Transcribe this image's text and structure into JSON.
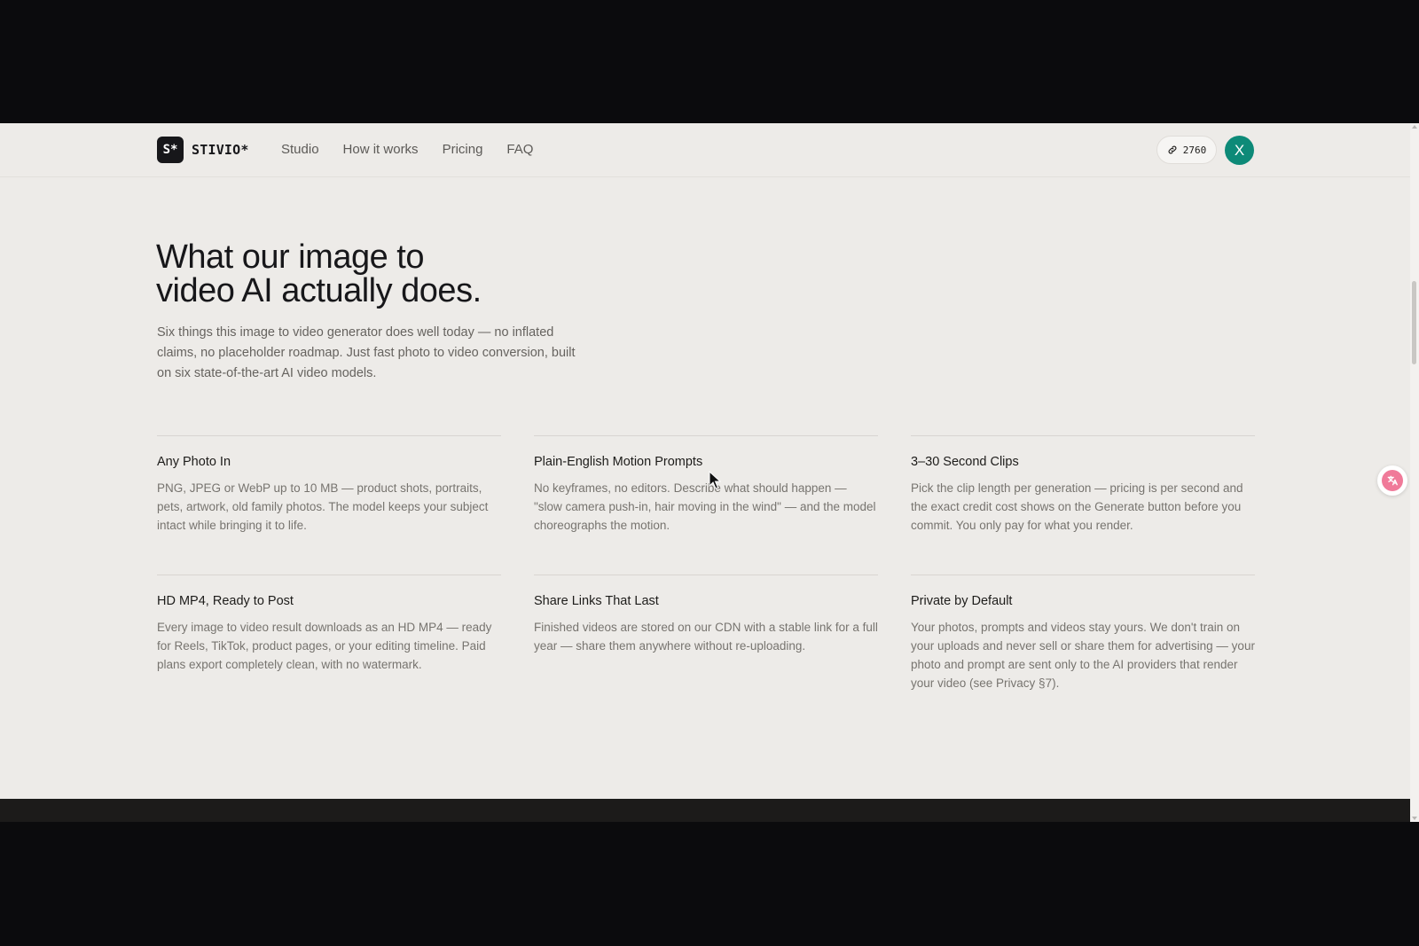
{
  "header": {
    "logo_mark": "S*",
    "logo_text": "STIVIO*",
    "nav": [
      "Studio",
      "How it works",
      "Pricing",
      "FAQ"
    ],
    "credits": "2760",
    "avatar_initial": "X"
  },
  "hero": {
    "title_line1": "What our image to",
    "title_line2": "video AI actually does.",
    "subtitle": "Six things this image to video generator does well today — no inflated claims, no placeholder roadmap. Just fast photo to video conversion, built on six state-of-the-art AI video models."
  },
  "features": [
    {
      "title": "Any Photo In",
      "text": "PNG, JPEG or WebP up to 10 MB — product shots, portraits, pets, artwork, old family photos. The model keeps your subject intact while bringing it to life."
    },
    {
      "title": "Plain-English Motion Prompts",
      "text": "No keyframes, no editors. Describe what should happen — \"slow camera push-in, hair moving in the wind\" — and the model choreographs the motion."
    },
    {
      "title": "3–30 Second Clips",
      "text": "Pick the clip length per generation — pricing is per second and the exact credit cost shows on the Generate button before you commit. You only pay for what you render."
    },
    {
      "title": "HD MP4, Ready to Post",
      "text": "Every image to video result downloads as an HD MP4 — ready for Reels, TikTok, product pages, or your editing timeline. Paid plans export completely clean, with no watermark."
    },
    {
      "title": "Share Links That Last",
      "text": "Finished videos are stored on our CDN with a stable link for a full year — share them anywhere without re-uploading."
    },
    {
      "title": "Private by Default",
      "text": "Your photos, prompts and videos stay yours. We don't train on your uploads and never sell or share them for advertising — your photo and prompt are sent only to the AI providers that render your video (see Privacy §7)."
    }
  ],
  "icons": {
    "credits": "link-icon",
    "widget": "translate-icon"
  },
  "colors": {
    "page_bg": "#edebe8",
    "avatar": "#0d8a78",
    "widget": "#f07a99"
  }
}
